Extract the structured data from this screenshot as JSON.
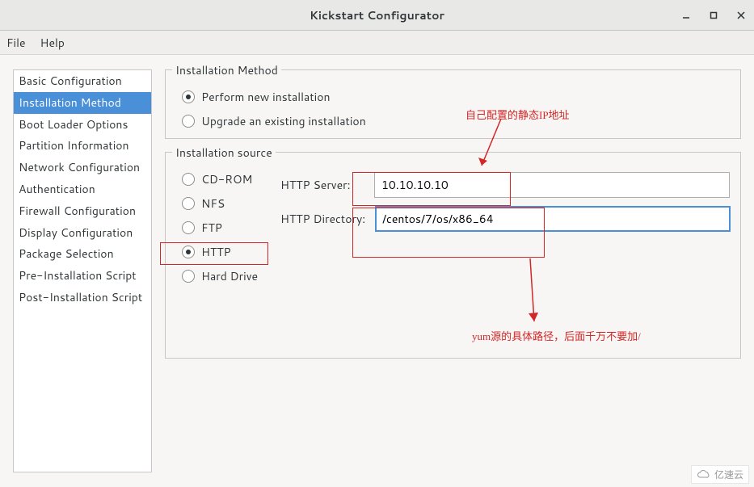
{
  "title": "Kickstart Configurator",
  "menu": {
    "file": "File",
    "help": "Help"
  },
  "sidebar": {
    "items": [
      "Basic Configuration",
      "Installation Method",
      "Boot Loader Options",
      "Partition Information",
      "Network Configuration",
      "Authentication",
      "Firewall Configuration",
      "Display Configuration",
      "Package Selection",
      "Pre-Installation Script",
      "Post-Installation Script"
    ],
    "selected_index": 1
  },
  "install_method": {
    "title": "Installation Method",
    "options": {
      "new": "Perform new installation",
      "upgrade": "Upgrade an existing installation"
    },
    "selected": "new"
  },
  "install_source": {
    "title": "Installation source",
    "options": {
      "cdrom": "CD-ROM",
      "nfs": "NFS",
      "ftp": "FTP",
      "http": "HTTP",
      "hd": "Hard Drive"
    },
    "selected": "http",
    "http_server_label": "HTTP Server:",
    "http_dir_label": "HTTP Directory:",
    "http_server_value": "10.10.10.10",
    "http_dir_value": "/centos/7/os/x86_64"
  },
  "annotations": {
    "ip_note": "自己配置的静态IP地址",
    "dir_note": "yum源的具体路径，后面千万不要加/"
  },
  "watermark": "亿速云"
}
